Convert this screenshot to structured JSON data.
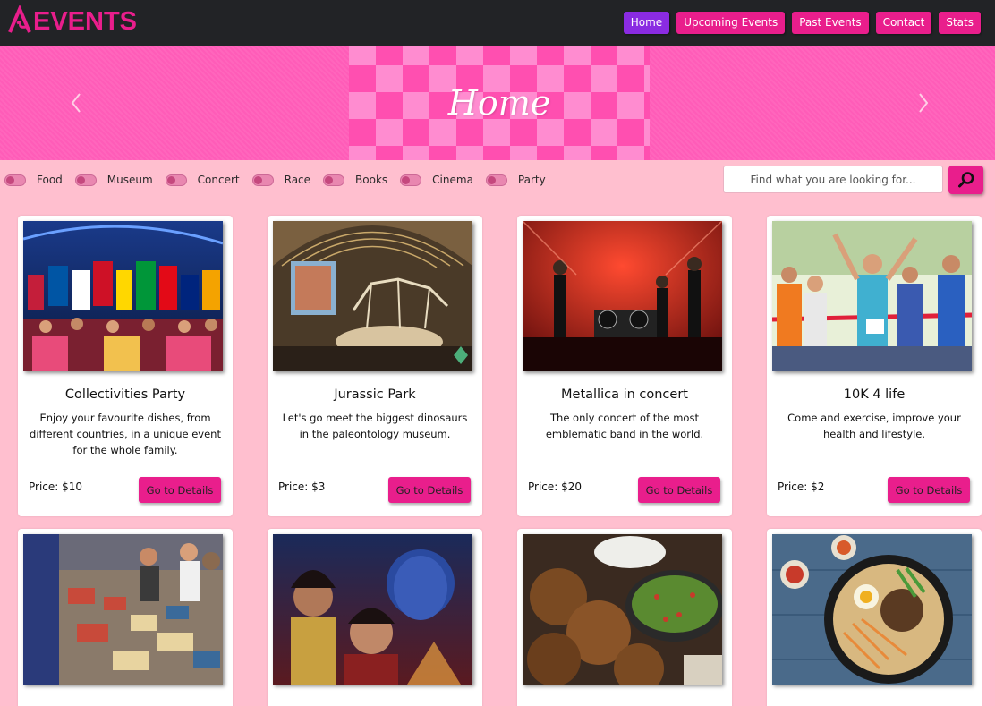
{
  "brand": {
    "name": "EVENTS",
    "mark": "A",
    "color": "#e91e8c"
  },
  "nav": {
    "home": "Home",
    "upcoming": "Upcoming Events",
    "past": "Past Events",
    "contact": "Contact",
    "stats": "Stats"
  },
  "hero": {
    "title": "Home",
    "prev_icon": "chevron-left-icon",
    "next_icon": "chevron-right-icon"
  },
  "filters": {
    "food": "Food",
    "museum": "Museum",
    "concert": "Concert",
    "race": "Race",
    "books": "Books",
    "cinema": "Cinema",
    "party": "Party"
  },
  "search": {
    "placeholder": "Find what you are looking for...",
    "icon": "search-icon"
  },
  "cards": [
    {
      "title": "Collectivities Party",
      "description": "Enjoy your favourite dishes, from different countries, in a unique event for the whole family.",
      "price": "Price: $10",
      "button": "Go to Details"
    },
    {
      "title": "Jurassic Park",
      "description": "Let's go meet the biggest dinosaurs in the paleontology museum.",
      "price": "Price: $3",
      "button": "Go to Details"
    },
    {
      "title": "Metallica in concert",
      "description": "The only concert of the most emblematic band in the world.",
      "price": "Price: $20",
      "button": "Go to Details"
    },
    {
      "title": "10K 4 life",
      "description": "Come and exercise, improve your health and lifestyle.",
      "price": "Price: $2",
      "button": "Go to Details"
    }
  ],
  "colors": {
    "navbar": "#222326",
    "accent": "#e91e8c",
    "active": "#8a2be2",
    "background": "#ffbfcf",
    "hero": "#ff5cb8"
  }
}
